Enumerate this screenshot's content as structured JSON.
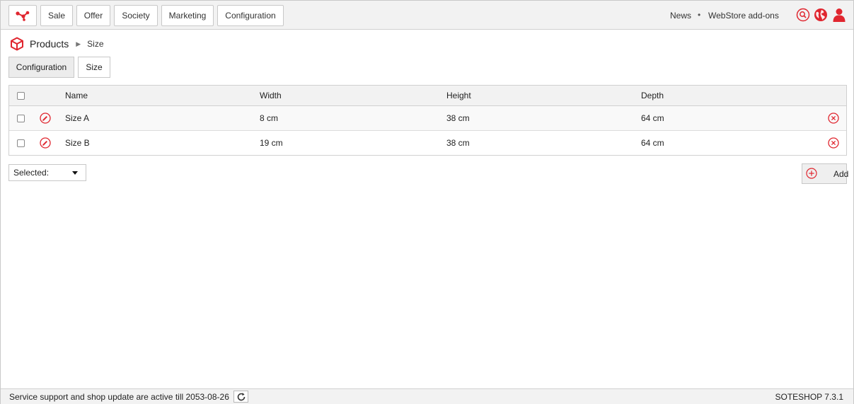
{
  "colors": {
    "accent": "#e0262f",
    "bar": "#f2f2f2",
    "border": "#c8c8c8"
  },
  "topnav": {
    "items": [
      {
        "label": "Sale"
      },
      {
        "label": "Offer"
      },
      {
        "label": "Society"
      },
      {
        "label": "Marketing"
      },
      {
        "label": "Configuration"
      }
    ],
    "links": {
      "news": "News",
      "separator": "•",
      "addons": "WebStore add-ons"
    },
    "icons": [
      "search-icon",
      "globe-icon",
      "user-icon"
    ]
  },
  "breadcrumb": {
    "root": "Products",
    "current": "Size"
  },
  "subtabs": {
    "configuration": "Configuration",
    "size": "Size"
  },
  "table": {
    "columns": {
      "name": "Name",
      "width": "Width",
      "height": "Height",
      "depth": "Depth"
    },
    "rows": [
      {
        "name": "Size A",
        "width": "8 cm",
        "height": "38 cm",
        "depth": "64 cm"
      },
      {
        "name": "Size B",
        "width": "19 cm",
        "height": "38 cm",
        "depth": "64 cm"
      }
    ]
  },
  "actions": {
    "selected_label": "Selected:",
    "add_label": "Add"
  },
  "footer": {
    "status": "Service support and shop update are active till 2053-08-26",
    "version": "SOTESHOP 7.3.1"
  }
}
